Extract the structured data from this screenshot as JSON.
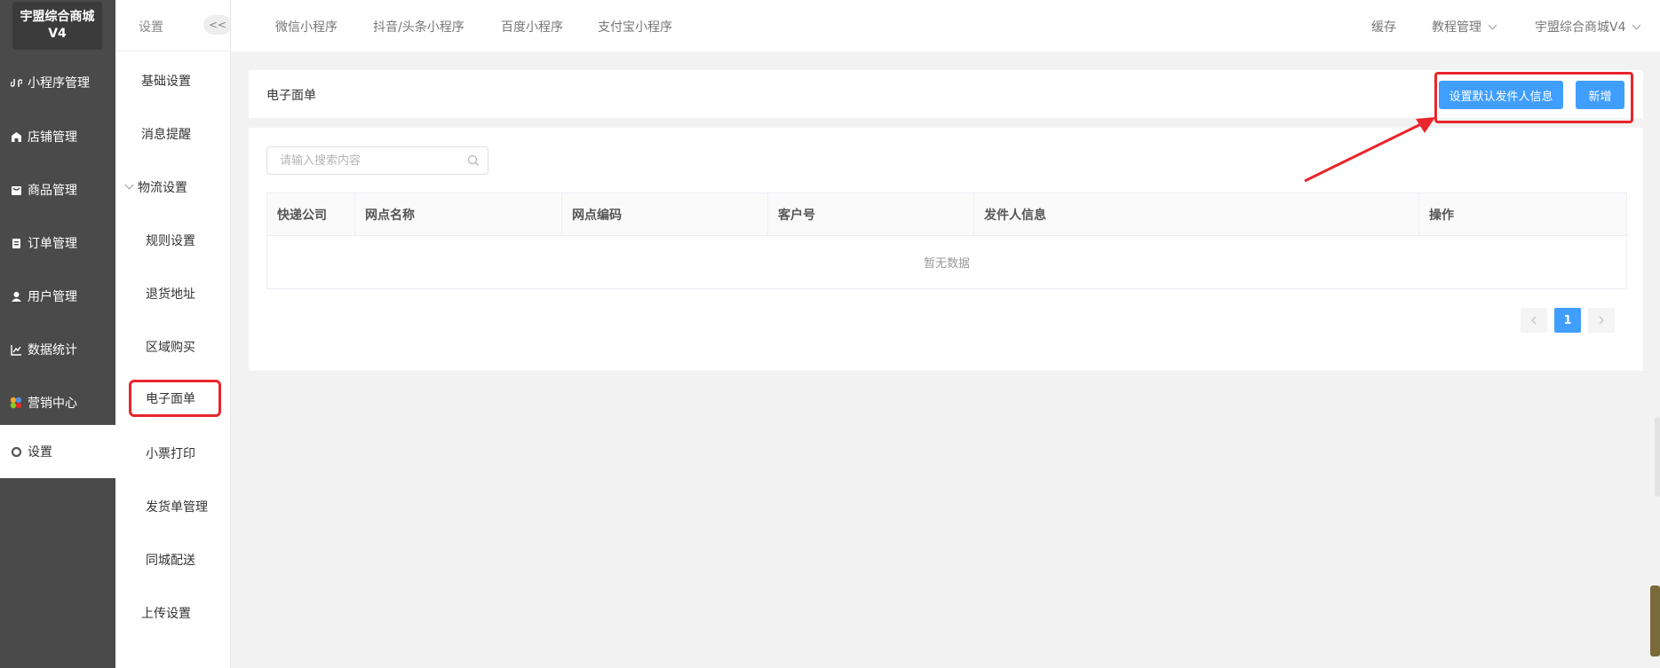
{
  "app": {
    "logo_line1": "宇盟综合商城",
    "logo_line2": "V4"
  },
  "main_menu": [
    {
      "label": "小程序管理",
      "icon": "miniprogram-icon"
    },
    {
      "label": "店铺管理",
      "icon": "store-icon"
    },
    {
      "label": "商品管理",
      "icon": "product-icon"
    },
    {
      "label": "订单管理",
      "icon": "order-icon"
    },
    {
      "label": "用户管理",
      "icon": "user-icon"
    },
    {
      "label": "数据统计",
      "icon": "chart-icon"
    },
    {
      "label": "营销中心",
      "icon": "marketing-icon"
    },
    {
      "label": "设置",
      "icon": "settings-icon"
    }
  ],
  "sub_menu": {
    "title": "设置",
    "collapse_label": "<<",
    "items": [
      {
        "label": "基础设置"
      },
      {
        "label": "消息提醒"
      },
      {
        "label": "物流设置"
      },
      {
        "label": "规则设置"
      },
      {
        "label": "退货地址"
      },
      {
        "label": "区域购买"
      },
      {
        "label": "电子面单"
      },
      {
        "label": "小票打印"
      },
      {
        "label": "发货单管理"
      },
      {
        "label": "同城配送"
      },
      {
        "label": "上传设置"
      }
    ]
  },
  "topbar": {
    "tabs": [
      "微信小程序",
      "抖音/头条小程序",
      "百度小程序",
      "支付宝小程序"
    ],
    "cache": "缓存",
    "tutorial": "教程管理",
    "store": "宇盟综合商城V4"
  },
  "page": {
    "title": "电子面单",
    "btn_default_sender": "设置默认发件人信息",
    "btn_add": "新增"
  },
  "search": {
    "placeholder": "请输入搜索内容",
    "value": ""
  },
  "table": {
    "columns": [
      "快递公司",
      "网点名称",
      "网点编码",
      "客户号",
      "发件人信息",
      "操作"
    ],
    "empty_text": "暂无数据"
  },
  "pagination": {
    "current": "1"
  },
  "colors": {
    "primary": "#409eff",
    "highlight": "#e8262c",
    "sidebar": "#4a4a4a"
  }
}
